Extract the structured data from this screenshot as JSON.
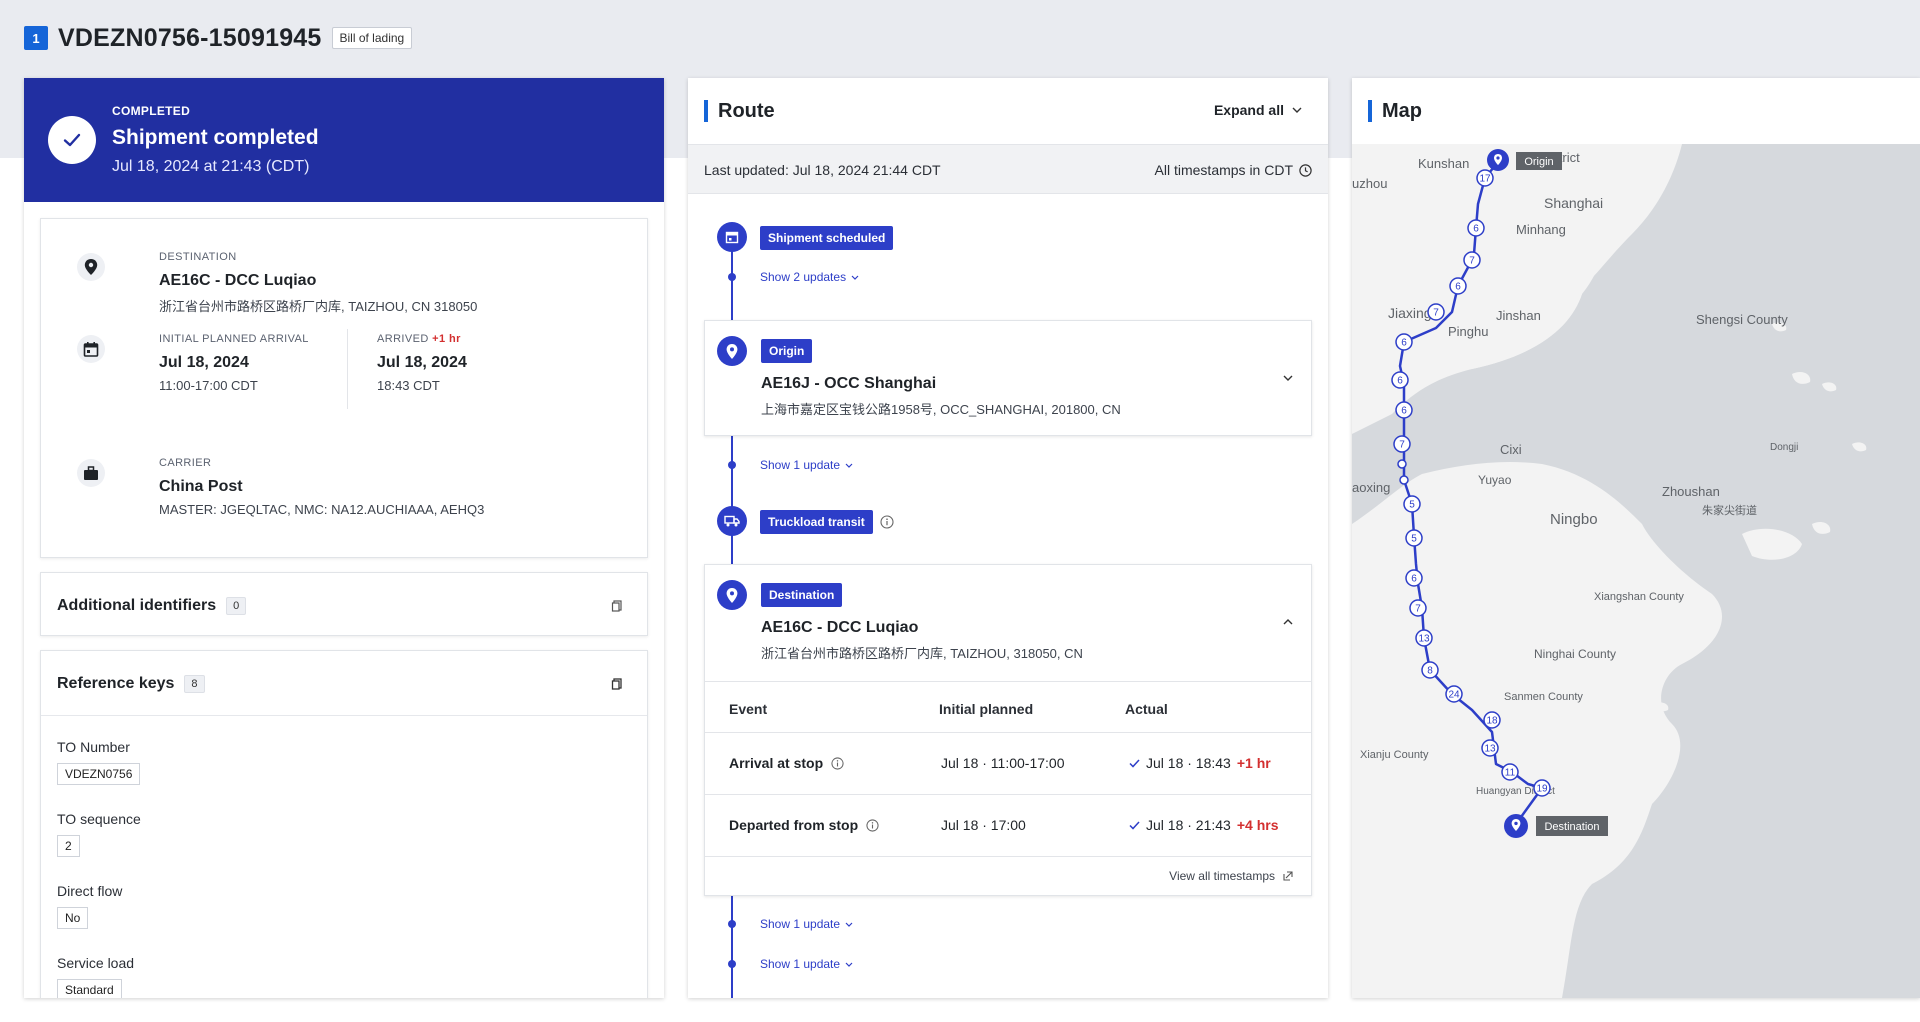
{
  "header": {
    "index": "1",
    "title": "VDEZN0756-15091945",
    "tag": "Bill of lading"
  },
  "status": {
    "label": "COMPLETED",
    "title": "Shipment completed",
    "time": "Jul 18, 2024 at 21:43 (CDT)"
  },
  "summary": {
    "destination": {
      "label": "DESTINATION",
      "name": "AE16C - DCC Luqiao",
      "address": "浙江省台州市路桥区路桥厂内库, TAIZHOU, CN 318050"
    },
    "planned": {
      "label": "INITIAL PLANNED ARRIVAL",
      "date": "Jul 18, 2024",
      "window": "11:00-17:00 CDT"
    },
    "arrived": {
      "label": "ARRIVED",
      "delta": "+1 hr",
      "date": "Jul 18, 2024",
      "time": "18:43 CDT"
    },
    "carrier": {
      "label": "CARRIER",
      "name": "China Post",
      "detail": "MASTER: JGEQLTAC, NMC: NA12.AUCHIAAA, AEHQ3"
    }
  },
  "identifiers": {
    "title": "Additional identifiers",
    "count": "0"
  },
  "reference_keys": {
    "title": "Reference keys",
    "count": "8",
    "items": [
      {
        "key": "TO Number",
        "value": "VDEZN0756"
      },
      {
        "key": "TO sequence",
        "value": "2"
      },
      {
        "key": "Direct flow",
        "value": "No"
      },
      {
        "key": "Service load",
        "value": "Standard"
      }
    ]
  },
  "route": {
    "title": "Route",
    "expand_label": "Expand all",
    "last_updated": "Last updated: Jul 18, 2024 21:44 CDT",
    "tz_note": "All timestamps in CDT",
    "scheduled": {
      "pill": "Shipment scheduled",
      "updates": "Show 2 updates"
    },
    "origin": {
      "pill": "Origin",
      "name": "AE16J - OCC Shanghai",
      "address": "上海市嘉定区宝钱公路1958号, OCC_SHANGHAI, 201800, CN",
      "updates": "Show 1 update"
    },
    "transit": {
      "pill": "Truckload transit"
    },
    "destination": {
      "pill": "Destination",
      "name": "AE16C - DCC Luqiao",
      "address": "浙江省台州市路桥区路桥厂内库, TAIZHOU, 318050, CN"
    },
    "events_header": {
      "event": "Event",
      "planned": "Initial planned",
      "actual": "Actual"
    },
    "events": [
      {
        "event": "Arrival at stop",
        "planned": "Jul 18 · 11:00-17:00",
        "actual": "Jul 18 · 18:43",
        "delta": "+1 hr"
      },
      {
        "event": "Departed from stop",
        "planned": "Jul 18 · 17:00",
        "actual": "Jul 18 · 21:43",
        "delta": "+4 hrs"
      }
    ],
    "view_all": "View all timestamps",
    "after_updates": [
      "Show 1 update",
      "Show 1 update"
    ]
  },
  "map": {
    "title": "Map",
    "origin_label": "Origin",
    "destination_label": "Destination",
    "place_labels": [
      "Kunshan",
      "District",
      "uzhou",
      "Shanghai",
      "Minhang",
      "Jiaxing",
      "Jinshan",
      "Pinghu",
      "Shengsi County",
      "Cixi",
      "Yuyao",
      "aoxing",
      "Zhoushan",
      "朱家尖街道",
      "Ningbo",
      "Xiangshan County",
      "Ninghai County",
      "Sanmen County",
      "Xianju County",
      "Huangyan District",
      "Dongji"
    ],
    "route_markers": [
      "17",
      "6",
      "7",
      "6",
      "7",
      "6",
      "6",
      "6",
      "7",
      "5",
      "5",
      "6",
      "7",
      "13",
      "8",
      "24",
      "18",
      "13",
      "11",
      "19"
    ],
    "colors": {
      "route": "#2d3ec8",
      "land": "#f5f5f5",
      "water": "#d6d9dd"
    }
  }
}
